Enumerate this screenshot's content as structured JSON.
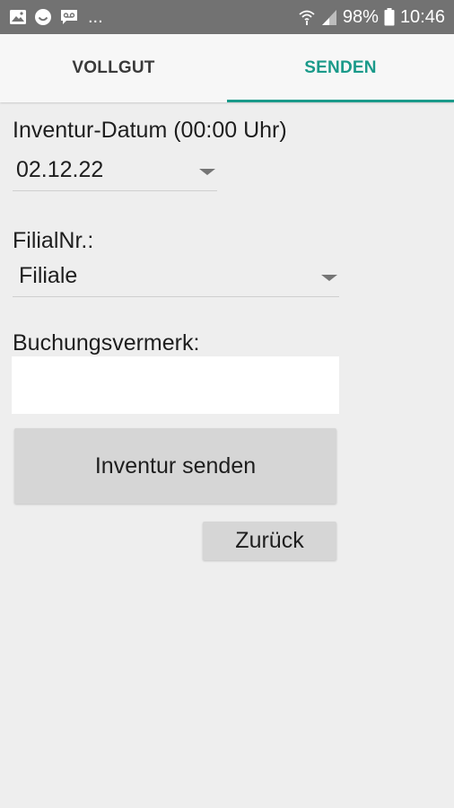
{
  "status_bar": {
    "notification_icons": [
      "image-icon",
      "smiley-icon",
      "voicemail-icon"
    ],
    "overflow": "...",
    "battery_percent": "98%",
    "time": "10:46"
  },
  "tabs": [
    {
      "label": "VOLLGUT",
      "active": false
    },
    {
      "label": "SENDEN",
      "active": true
    }
  ],
  "accent_color": "#1a9a8a",
  "form": {
    "date_label": "Inventur-Datum (00:00 Uhr)",
    "date_value": "02.12.22",
    "branch_label": "FilialNr.:",
    "branch_value": "Filiale",
    "note_label": "Buchungsvermerk:",
    "note_value": "",
    "send_button": "Inventur senden",
    "back_button": "Zurück"
  }
}
